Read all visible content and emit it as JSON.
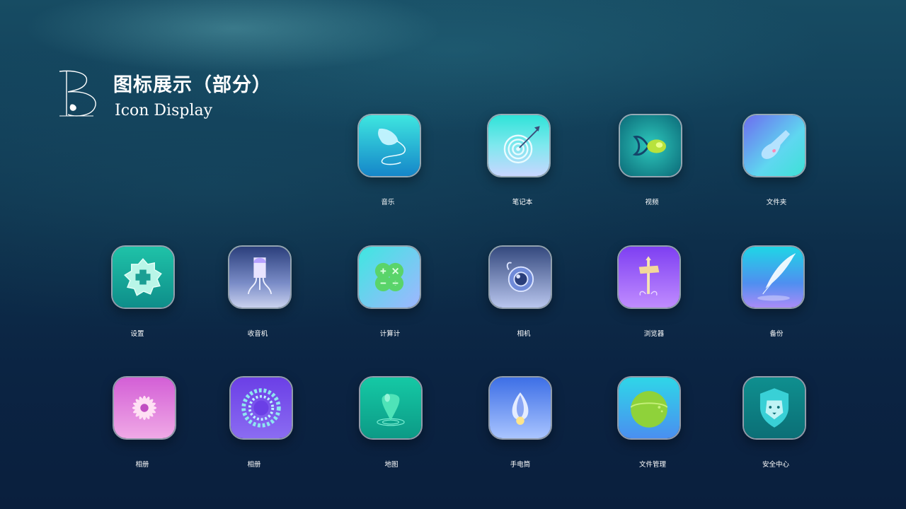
{
  "header": {
    "title_cn": "图标展示（部分）",
    "title_en": "Icon Display"
  },
  "icons": [
    {
      "label": "音乐",
      "icon": "music-icon"
    },
    {
      "label": "笔记本",
      "icon": "notebook-icon"
    },
    {
      "label": "视频",
      "icon": "video-icon"
    },
    {
      "label": "文件夹",
      "icon": "folder-icon"
    },
    {
      "label": "设置",
      "icon": "settings-icon"
    },
    {
      "label": "收音机",
      "icon": "radio-icon"
    },
    {
      "label": "计算计",
      "icon": "calculator-icon"
    },
    {
      "label": "相机",
      "icon": "camera-icon"
    },
    {
      "label": "浏览器",
      "icon": "browser-icon"
    },
    {
      "label": "备份",
      "icon": "backup-icon"
    },
    {
      "label": "相册",
      "icon": "album-icon"
    },
    {
      "label": "相册",
      "icon": "album-icon"
    },
    {
      "label": "地图",
      "icon": "map-icon"
    },
    {
      "label": "手电筒",
      "icon": "flashlight-icon"
    },
    {
      "label": "文件管理",
      "icon": "file-manager-icon"
    },
    {
      "label": "安全中心",
      "icon": "security-center-icon"
    }
  ]
}
